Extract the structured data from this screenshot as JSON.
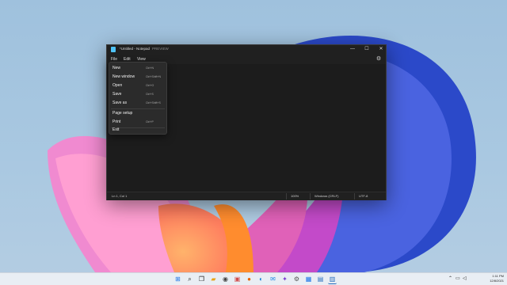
{
  "window": {
    "title": "*Untitled - Notepad",
    "badge": "PREVIEW",
    "controls": {
      "minimize": "—",
      "maximize": "☐",
      "close": "✕"
    }
  },
  "menubar": {
    "file": "File",
    "edit": "Edit",
    "view": "View",
    "settings_icon": "gear-icon"
  },
  "file_menu": {
    "items": [
      {
        "label": "New",
        "shortcut": "Ctrl+N"
      },
      {
        "label": "New window",
        "shortcut": "Ctrl+Shift+N"
      },
      {
        "label": "Open",
        "shortcut": "Ctrl+O"
      },
      {
        "label": "Save",
        "shortcut": "Ctrl+S"
      },
      {
        "label": "Save as",
        "shortcut": "Ctrl+Shift+S"
      },
      {
        "label": "Page setup",
        "shortcut": ""
      },
      {
        "label": "Print",
        "shortcut": "Ctrl+P"
      },
      {
        "label": "Exit",
        "shortcut": ""
      }
    ]
  },
  "statusbar": {
    "position": "Ln 1, Col 1",
    "zoom": "100%",
    "line_ending": "Windows (CRLF)",
    "encoding": "UTF-8"
  },
  "taskbar": {
    "time": "1:11 PM",
    "date": "12/8/2021",
    "apps": [
      "windows-start-icon",
      "search-icon",
      "task-view-icon",
      "file-explorer-icon",
      "edge-icon",
      "store-icon",
      "firefox-icon",
      "photos-icon",
      "mail-icon",
      "settings-icon",
      "calculator-icon",
      "notepad-icon"
    ]
  },
  "colors": {
    "accent": "#4fc3f7",
    "window_bg": "#202020",
    "menu_bg": "#2b2b2b"
  }
}
